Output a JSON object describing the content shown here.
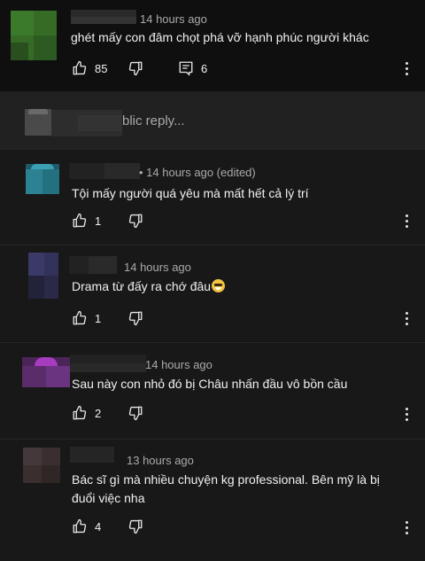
{
  "colors": {
    "background": "#181818",
    "top_comment_bg": "#0f0f0f",
    "reply_bar_bg": "#212121",
    "text": "#f1f1f1",
    "meta": "#aaaaaa"
  },
  "top_comment": {
    "time": "14 hours ago",
    "text": "ghét mấy con đâm chọt phá vỡ hạnh phúc người khác",
    "likes": "85",
    "replies": "6",
    "icons": [
      "thumb-up-icon",
      "thumb-down-icon",
      "reply-icon",
      "more-vertical-icon"
    ]
  },
  "public_reply": {
    "placeholder": "blic reply..."
  },
  "replies": [
    {
      "time": "14 hours ago",
      "edited": "• 14 hours ago (edited)",
      "text": "Tội mấy người quá yêu mà mất hết cả lý trí",
      "likes": "1"
    },
    {
      "time": "14 hours ago",
      "text": "Drama từ đấy ra chớ đâu",
      "likes": "1",
      "emoji": "grimacing-face"
    },
    {
      "time": "14 hours ago",
      "text": "Sau này con nhỏ đó bị Châu nhấn đầu vô bồn cầu",
      "likes": "2"
    },
    {
      "time": "13 hours ago",
      "text": "Bác sĩ gì mà nhiều chuyện kg professional. Bên mỹ là bị đuổi việc nha",
      "likes": "4"
    }
  ]
}
